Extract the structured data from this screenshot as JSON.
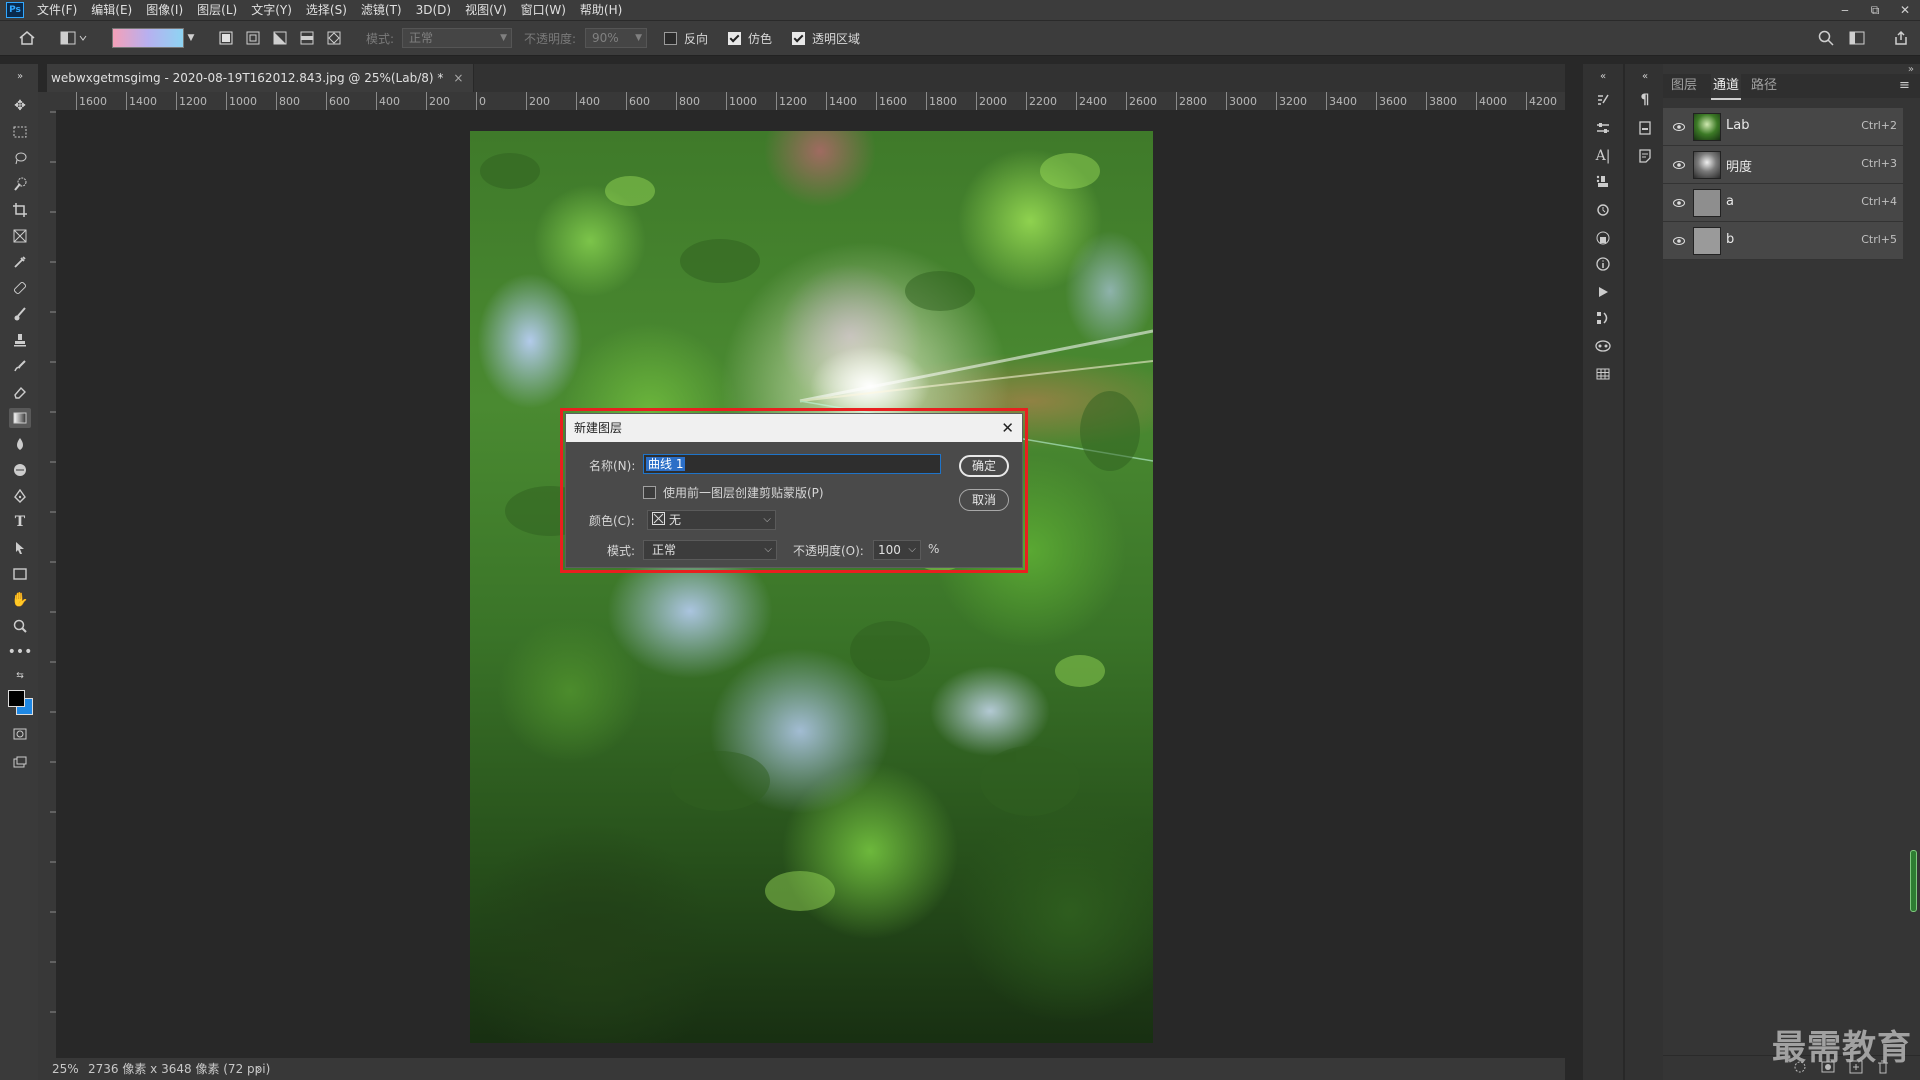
{
  "app": {
    "logo": "Ps",
    "menu": [
      "文件(F)",
      "编辑(E)",
      "图像(I)",
      "图层(L)",
      "文字(Y)",
      "选择(S)",
      "滤镜(T)",
      "3D(D)",
      "视图(V)",
      "窗口(W)",
      "帮助(H)"
    ],
    "window_controls": [
      "‒",
      "⧉",
      "✕"
    ]
  },
  "options_bar": {
    "mode_label": "模式:",
    "mode_value": "正常",
    "opacity_label": "不透明度:",
    "opacity_value": "90%",
    "reverse_label": "反向",
    "reverse_checked": false,
    "dither_label": "仿色",
    "dither_checked": true,
    "transparency_label": "透明区域",
    "transparency_checked": true
  },
  "document": {
    "tab_title": "webwxgetmsgimg - 2020-08-19T162012.843.jpg @ 25%(Lab/8) *",
    "tab_close": "×",
    "zoom": "25%",
    "status_info": "2736 像素 x 3648 像素 (72 ppi)",
    "status_arrow": "›"
  },
  "ruler": {
    "top_labels": [
      "1600",
      "1400",
      "1200",
      "1000",
      "800",
      "600",
      "400",
      "200",
      "0",
      "200",
      "400",
      "600",
      "800",
      "1000",
      "1200",
      "1400",
      "1600",
      "1800",
      "2000",
      "2200",
      "2400",
      "2600",
      "2800",
      "3000",
      "3200",
      "3400",
      "3600",
      "3800",
      "4000",
      "4200"
    ]
  },
  "channels_panel": {
    "tabs": [
      "图层",
      "通道",
      "路径"
    ],
    "active_tab": "通道",
    "menu_icon": "≡",
    "rows": [
      {
        "name": "Lab",
        "shortcut": "Ctrl+2"
      },
      {
        "name": "明度",
        "shortcut": "Ctrl+3"
      },
      {
        "name": "a",
        "shortcut": "Ctrl+4"
      },
      {
        "name": "b",
        "shortcut": "Ctrl+5"
      }
    ]
  },
  "dialog": {
    "title": "新建图层",
    "close": "✕",
    "name_label": "名称(N):",
    "name_value": "曲线 1",
    "clip_label": "使用前一图层创建剪贴蒙版(P)",
    "clip_checked": false,
    "color_label": "颜色(C):",
    "color_value": "无",
    "mode_label": "模式:",
    "mode_value": "正常",
    "opacity_label": "不透明度(O):",
    "opacity_value": "100",
    "opacity_unit": "%",
    "ok_label": "确定",
    "cancel_label": "取消"
  },
  "watermark": "最需教育",
  "colors": {
    "accent": "#31a8ff",
    "highlight_outline": "#e8201f",
    "selection": "#2c6fc7"
  }
}
